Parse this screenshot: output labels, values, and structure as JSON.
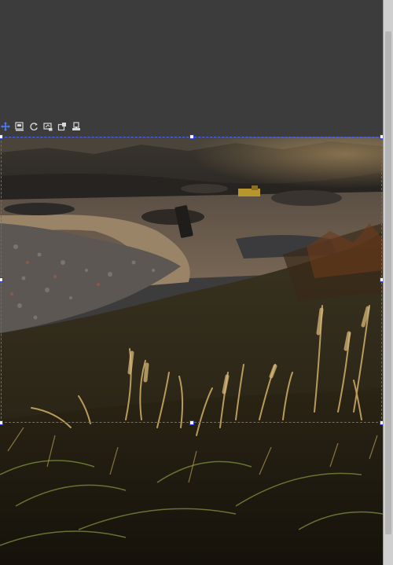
{
  "workspace": {
    "background": "#3c3c3c",
    "scrollbar_color": "#cfcfcf"
  },
  "toolbar": {
    "icons": [
      {
        "name": "move-icon",
        "color": "#4a7dff"
      },
      {
        "name": "fit-image-icon",
        "color": "#d8d8d8"
      },
      {
        "name": "rotate-icon",
        "color": "#d8d8d8"
      },
      {
        "name": "resize-image-icon",
        "color": "#d8d8d8"
      },
      {
        "name": "crop-icon",
        "color": "#d8d8d8"
      },
      {
        "name": "stamp-icon",
        "color": "#d8d8d8"
      }
    ]
  },
  "selection": {
    "border_color": "#4a62ff",
    "handle_color": "#ffffff"
  },
  "photo": {
    "subject": "quarry-landscape-with-grass"
  }
}
